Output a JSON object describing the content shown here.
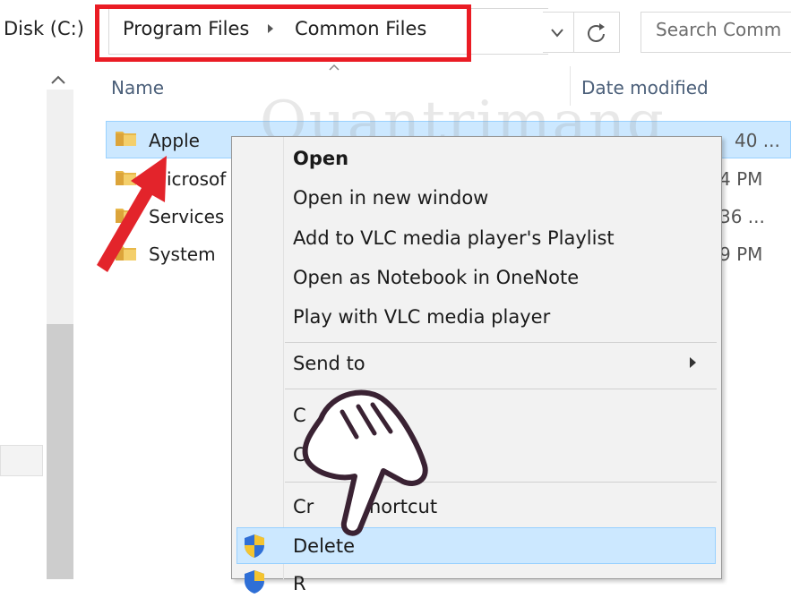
{
  "address_bar": {
    "disk_label": "Disk (C:)",
    "breadcrumb": [
      "Program Files",
      "Common Files"
    ],
    "search_placeholder": "Search Comm"
  },
  "columns": {
    "name": "Name",
    "date_modified": "Date modified"
  },
  "files": [
    {
      "name": "Apple",
      "date": "40 ...",
      "selected": true
    },
    {
      "name": "icrosof",
      "date": "4 PM"
    },
    {
      "name": "Services",
      "date": "36 ..."
    },
    {
      "name": "System",
      "date": "9 PM"
    }
  ],
  "context_menu": {
    "items": [
      {
        "label": "Open",
        "bold": true
      },
      {
        "label": "Open in new window"
      },
      {
        "label": "Add to VLC media player's Playlist"
      },
      {
        "label": "Open as Notebook in OneNote"
      },
      {
        "label": "Play with VLC media player"
      },
      {
        "label": "Send to",
        "submenu": true
      },
      {
        "label": "C"
      },
      {
        "label": "C"
      },
      {
        "label": "Cr"
      },
      {
        "label": "shortcut"
      },
      {
        "label": "Delete",
        "highlighted": true,
        "icon": "uac-shield-icon"
      },
      {
        "label": "R",
        "icon": "uac-shield-icon"
      }
    ]
  },
  "watermark": "Quantrimang",
  "colors": {
    "highlight_box": "#ea1c24",
    "selection": "#cce8ff",
    "menu_bg": "#f2f2f2",
    "folder": "#e8b84a"
  }
}
